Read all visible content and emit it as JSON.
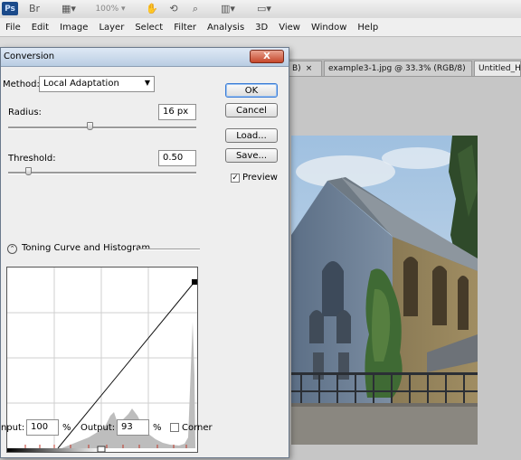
{
  "app": {
    "logo": "Ps",
    "zoom": "100%",
    "menu": [
      "File",
      "Edit",
      "Image",
      "Layer",
      "Select",
      "Filter",
      "Analysis",
      "3D",
      "View",
      "Window",
      "Help"
    ]
  },
  "toolbar_icons": [
    "bridge-icon",
    "mini-bridge-icon",
    "view-extras-icon",
    "zoom-level-box",
    "hand-icon",
    "rotate-view-icon",
    "zoom-icon",
    "arrange-documents-icon",
    "screen-mode-icon"
  ],
  "doc_tabs": [
    {
      "label": "B)",
      "close": "×"
    },
    {
      "label": "example3-1.jpg @ 33.3% (RGB/8)",
      "close": "×"
    },
    {
      "label": "Untitled_HD"
    }
  ],
  "dialog": {
    "title": "Conversion",
    "close_label": "X",
    "method_label": "Method:",
    "method_value": "Local Adaptation",
    "radius_label": "Radius:",
    "radius_value": "16 px",
    "radius_slider_fraction": 0.5,
    "threshold_label": "Threshold:",
    "threshold_value": "0.50",
    "threshold_slider_fraction": 0.1,
    "section_title": "Toning Curve and Histogram",
    "input_label": "Input:",
    "input_value": "100",
    "input_unit": "%",
    "output_label": "Output:",
    "output_value": "93",
    "output_unit": "%",
    "corner_label": "Corner",
    "corner_checked": false,
    "buttons": {
      "ok": "OK",
      "cancel": "Cancel",
      "load": "Load...",
      "save": "Save..."
    },
    "preview_label": "Preview",
    "preview_checked": true
  },
  "colors": {
    "accent": "#3a7bd5",
    "close_button": "#c6462a",
    "histogram": "#bdbdbd",
    "marker": "#c0392b"
  }
}
